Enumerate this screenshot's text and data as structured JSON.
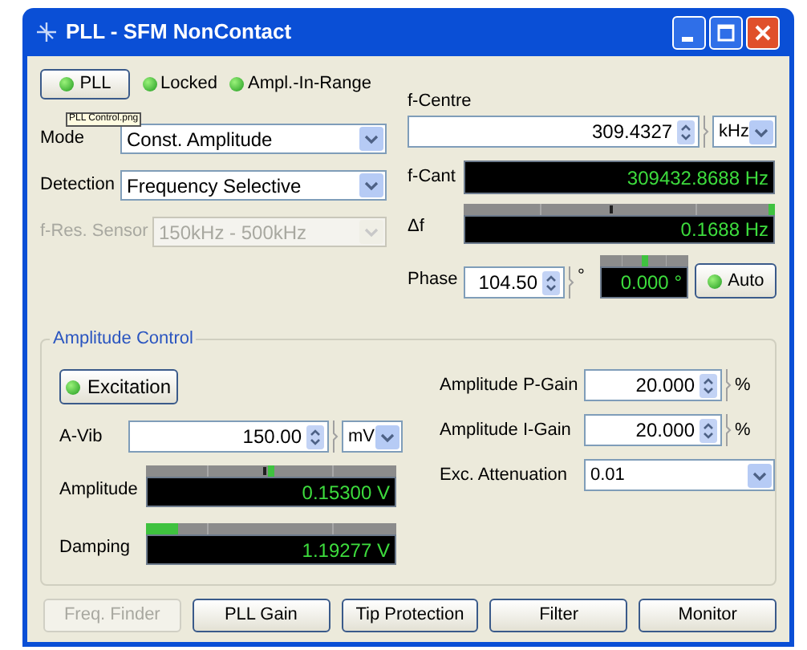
{
  "window": {
    "title": "PLL - SFM NonContact"
  },
  "pll": {
    "button": {
      "label": "PLL",
      "on": true
    },
    "indicators": [
      {
        "label": "Locked",
        "on": true
      },
      {
        "label": "Ampl.-In-Range",
        "on": true
      }
    ],
    "tooltip": "PLL Control.png",
    "selectors": [
      {
        "label": "Mode",
        "value": "Const. Amplitude",
        "disabled": false
      },
      {
        "label": "Detection",
        "value": "Frequency Selective",
        "disabled": false
      },
      {
        "label": "f-Res. Sensor",
        "value": "150kHz - 500kHz",
        "disabled": true
      }
    ]
  },
  "frequency": {
    "centre": {
      "label": "f-Centre",
      "value": "309.4327",
      "unit": "kHz"
    },
    "cant": {
      "label": "f-Cant",
      "reading": "309432.8688 Hz"
    },
    "delta": {
      "label": "Δf",
      "reading": "0.1688 Hz",
      "level": 1.0
    },
    "phase": {
      "label": "Phase",
      "value": "104.50",
      "unit": "°",
      "reading": "0.000 °",
      "level": 0.5
    },
    "auto": {
      "label": "Auto",
      "on": true
    }
  },
  "amplitude_control": {
    "title": "Amplitude Control",
    "excitation": {
      "label": "Excitation",
      "on": true
    },
    "a_vib": {
      "label": "A-Vib",
      "value": "150.00",
      "unit": "mV"
    },
    "meters": [
      {
        "label": "Amplitude",
        "reading": "0.15300 V",
        "kind": "pointer",
        "level": 0.5
      },
      {
        "label": "Damping",
        "reading": "1.19277 V",
        "kind": "fill",
        "level": 0.13
      }
    ],
    "gains": [
      {
        "label": "Amplitude P-Gain",
        "value": "20.000",
        "unit": "%"
      },
      {
        "label": "Amplitude I-Gain",
        "value": "20.000",
        "unit": "%"
      }
    ],
    "attenuation": {
      "label": "Exc. Attenuation",
      "value": "0.01"
    }
  },
  "buttons": [
    {
      "label": "Freq. Finder",
      "disabled": true
    },
    {
      "label": "PLL Gain",
      "disabled": false
    },
    {
      "label": "Tip Protection",
      "disabled": false
    },
    {
      "label": "Filter",
      "disabled": false
    },
    {
      "label": "Monitor",
      "disabled": false
    }
  ]
}
